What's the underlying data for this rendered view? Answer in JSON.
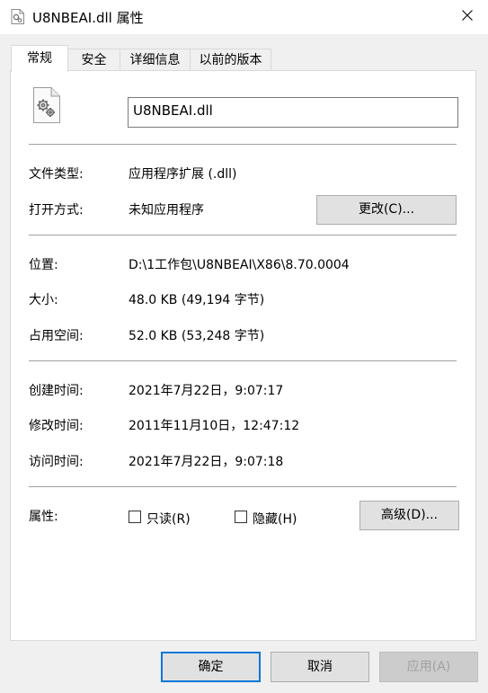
{
  "window": {
    "title": "U8NBEAI.dll 属性",
    "close_icon": "close-icon"
  },
  "tabs": [
    {
      "label": "常规",
      "active": true
    },
    {
      "label": "安全",
      "active": false
    },
    {
      "label": "详细信息",
      "active": false
    },
    {
      "label": "以前的版本",
      "active": false
    }
  ],
  "file": {
    "icon": "dll-file-icon",
    "name": "U8NBEAI.dll"
  },
  "type_section": {
    "type_label": "文件类型:",
    "type_value": "应用程序扩展 (.dll)",
    "open_label": "打开方式:",
    "open_value": "未知应用程序",
    "change_button": "更改(C)..."
  },
  "location_section": {
    "location_label": "位置:",
    "location_value": "D:\\1工作包\\U8NBEAI\\X86\\8.70.0004",
    "size_label": "大小:",
    "size_value": "48.0 KB (49,194 字节)",
    "disk_label": "占用空间:",
    "disk_value": "52.0 KB (53,248 字节)"
  },
  "time_section": {
    "created_label": "创建时间:",
    "created_value": "2021年7月22日，9:07:17",
    "modified_label": "修改时间:",
    "modified_value": "2011年11月10日，12:47:12",
    "accessed_label": "访问时间:",
    "accessed_value": "2021年7月22日，9:07:18"
  },
  "attributes": {
    "label": "属性:",
    "readonly_label": "只读(R)",
    "readonly_checked": false,
    "hidden_label": "隐藏(H)",
    "hidden_checked": false,
    "advanced_button": "高级(D)..."
  },
  "footer": {
    "ok": "确定",
    "cancel": "取消",
    "apply": "应用(A)"
  },
  "colors": {
    "accent": "#0078d7",
    "window_bg": "#f0f0f0",
    "panel_bg": "#ffffff"
  }
}
